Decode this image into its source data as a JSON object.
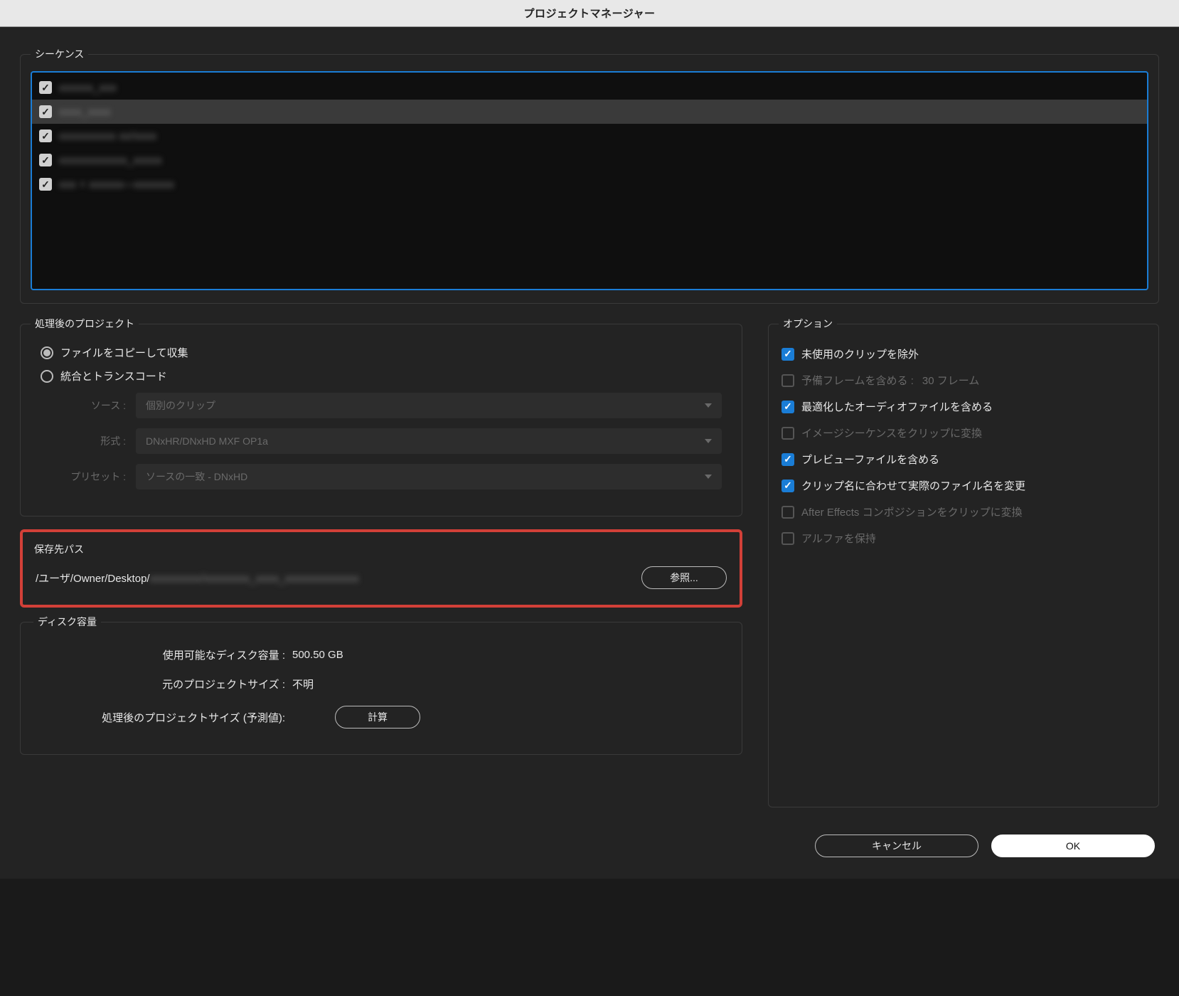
{
  "title": "プロジェクトマネージャー",
  "sequence_group": {
    "label": "シーケンス",
    "items": [
      {
        "name": "xxxxxx_xxx",
        "checked": true
      },
      {
        "name": "xxxx_xxxx",
        "checked": true,
        "hover": true
      },
      {
        "name": "xxxxxxxxxx xx/xxxx",
        "checked": true
      },
      {
        "name": "xxxxxxxxxxxx_xxxxx",
        "checked": true
      },
      {
        "name": "xxx + xxxxxx—xxxxxxx",
        "checked": true
      }
    ]
  },
  "resulting_project": {
    "label": "処理後のプロジェクト",
    "radio_copy": "ファイルをコピーして収集",
    "radio_transcode": "統合とトランスコード",
    "selected": "copy",
    "source_label": "ソース :",
    "source_value": "個別のクリップ",
    "format_label": "形式 :",
    "format_value": "DNxHR/DNxHD MXF OP1a",
    "preset_label": "プリセット :",
    "preset_value": "ソースの一致 - DNxHD"
  },
  "options": {
    "label": "オプション",
    "items": [
      {
        "key": "exclude_unused",
        "label": "未使用のクリップを除外",
        "checked": true,
        "enabled": true
      },
      {
        "key": "include_handles",
        "label": "予備フレームを含める :",
        "extra": "30 フレーム",
        "checked": false,
        "enabled": false
      },
      {
        "key": "include_audio_conform",
        "label": "最適化したオーディオファイルを含める",
        "checked": true,
        "enabled": true
      },
      {
        "key": "img_seq_to_clip",
        "label": "イメージシーケンスをクリップに変換",
        "checked": false,
        "enabled": false
      },
      {
        "key": "include_preview",
        "label": "プレビューファイルを含める",
        "checked": true,
        "enabled": true
      },
      {
        "key": "rename_media",
        "label": "クリップ名に合わせて実際のファイル名を変更",
        "checked": true,
        "enabled": true
      },
      {
        "key": "ae_comp_to_clip",
        "label": "After Effects コンポジションをクリップに変換",
        "checked": false,
        "enabled": false
      },
      {
        "key": "preserve_alpha",
        "label": "アルファを保持",
        "checked": false,
        "enabled": false
      }
    ]
  },
  "destination": {
    "label": "保存先パス",
    "visible_path": "/ユーザ/Owner/Desktop/",
    "hidden_path": "xxxxxxxxx/xxxxxxxx_xxxx_xxxxxxxxxxxxx",
    "browse": "参照..."
  },
  "disk": {
    "label": "ディスク容量",
    "available_label": "使用可能なディスク容量 :",
    "available_value": "500.50 GB",
    "original_label": "元のプロジェクトサイズ :",
    "original_value": "不明",
    "resulting_label": "処理後のプロジェクトサイズ (予測値):",
    "calculate": "計算"
  },
  "buttons": {
    "cancel": "キャンセル",
    "ok": "OK"
  }
}
